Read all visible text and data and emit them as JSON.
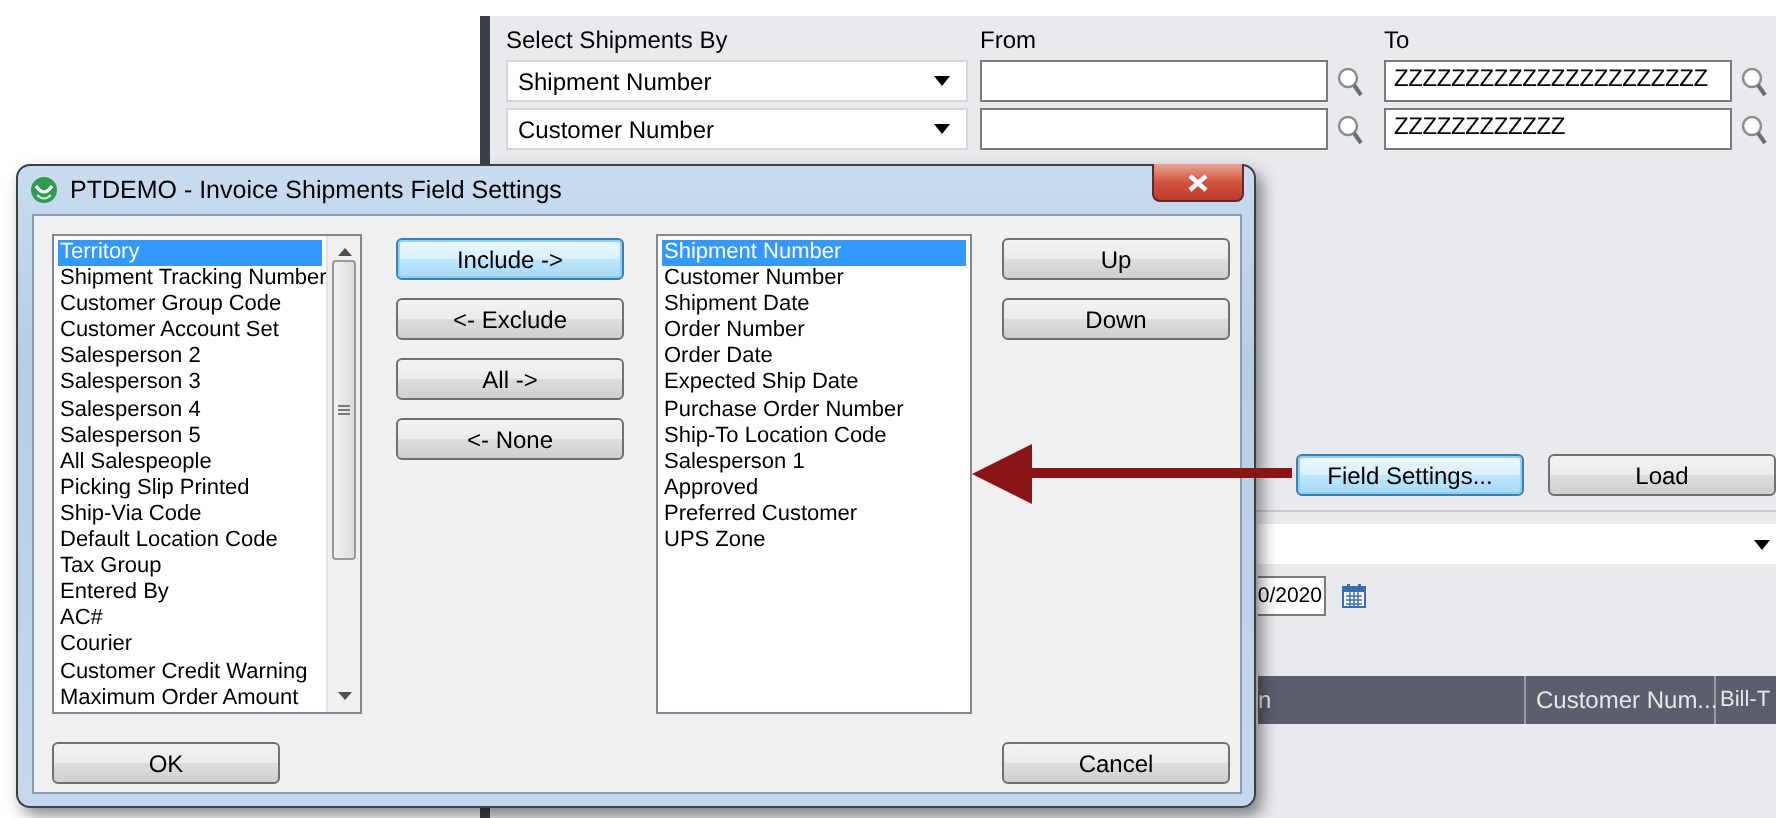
{
  "app": {
    "select_label": "Select Shipments By",
    "from_label": "From",
    "to_label": "To",
    "criteria": [
      {
        "field": "Shipment Number",
        "to": "ZZZZZZZZZZZZZZZZZZZZZZ"
      },
      {
        "field": "Customer Number",
        "to": "ZZZZZZZZZZZZ"
      }
    ],
    "buttons": [
      {
        "label": "Field Settings...",
        "focused": true
      },
      {
        "label": "Load",
        "focused": false
      }
    ],
    "date": "0/2020",
    "table": {
      "columns": [
        "n",
        "Customer Num...",
        "Bill-T"
      ]
    }
  },
  "dialog": {
    "title": "PTDEMO - Invoice Shipments Field Settings",
    "available_fields": [
      {
        "label": "Territory",
        "selected": true
      },
      {
        "label": "Shipment Tracking Number",
        "selected": false
      },
      {
        "label": "Customer Group Code",
        "selected": false
      },
      {
        "label": "Customer Account Set",
        "selected": false
      },
      {
        "label": "Salesperson 2",
        "selected": false
      },
      {
        "label": "Salesperson 3",
        "selected": false
      },
      {
        "label": "Salesperson 4",
        "selected": false
      },
      {
        "label": "Salesperson 5",
        "selected": false
      },
      {
        "label": "All Salespeople",
        "selected": false
      },
      {
        "label": "Picking Slip Printed",
        "selected": false
      },
      {
        "label": "Ship-Via Code",
        "selected": false
      },
      {
        "label": "Default Location Code",
        "selected": false
      },
      {
        "label": "Tax Group",
        "selected": false
      },
      {
        "label": "Entered By",
        "selected": false
      },
      {
        "label": "AC#",
        "selected": false
      },
      {
        "label": "Courier",
        "selected": false
      },
      {
        "label": "Customer Credit Warning",
        "selected": false
      },
      {
        "label": "Maximum Order Amount",
        "selected": false
      }
    ],
    "move_buttons": [
      {
        "label": "Include ->",
        "focused": true
      },
      {
        "label": "<- Exclude",
        "focused": false
      },
      {
        "label": "All ->",
        "focused": false
      },
      {
        "label": "<- None",
        "focused": false
      }
    ],
    "selected_fields": [
      {
        "label": "Shipment Number",
        "selected": true
      },
      {
        "label": "Customer Number",
        "selected": false
      },
      {
        "label": "Shipment Date",
        "selected": false
      },
      {
        "label": "Order Number",
        "selected": false
      },
      {
        "label": "Order Date",
        "selected": false
      },
      {
        "label": "Expected Ship Date",
        "selected": false
      },
      {
        "label": "Purchase Order Number",
        "selected": false
      },
      {
        "label": "Ship-To Location Code",
        "selected": false
      },
      {
        "label": "Salesperson 1",
        "selected": false
      },
      {
        "label": "Approved",
        "selected": false
      },
      {
        "label": "Preferred Customer",
        "selected": false
      },
      {
        "label": "UPS Zone",
        "selected": false
      }
    ],
    "order_buttons": [
      {
        "label": "Up",
        "focused": false
      },
      {
        "label": "Down",
        "focused": false
      }
    ],
    "ok_button": "OK",
    "cancel_button": "Cancel"
  }
}
